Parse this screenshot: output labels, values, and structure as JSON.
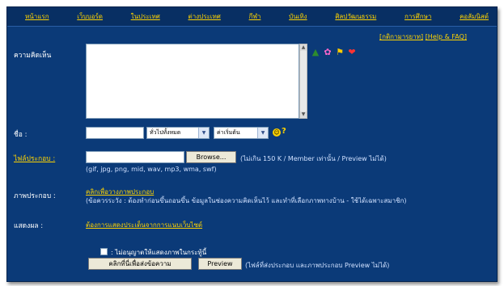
{
  "nav": [
    "หน้าแรก",
    "เว็บบอร์ด",
    "ในประเทศ",
    "ต่างประเทศ",
    "กีฬา",
    "บันเทิง",
    "ศิลปวัฒนธรรม",
    "การศึกษา",
    "คอลัมนิสต์"
  ],
  "help_links": {
    "terms": "[กติกามารยาท]",
    "help": "[Help & FAQ]"
  },
  "labels": {
    "opinion": "ความคิดเห็น",
    "name": "ชื่อ :",
    "attach": "ไฟล์ประกอบ :",
    "image_url": "ภาพประกอบ :",
    "url": "แสดงผล :"
  },
  "name_select": "ทั่วไปทั้งหมด",
  "color_select": "ค่าเริ่มต้น",
  "browse_label": "Browse...",
  "attach_note": "(ไม่เกิน 150 K / Member เท่านั้น / Preview ไม่ได้)",
  "attach_types": "(gif, jpg, png, mid, wav, mp3, wma, swf)",
  "image_link": "คลิกเพื่อวางภาพประกอบ",
  "image_note": "(ข้อควรระวัง : ต้องทำก่อนขึ้นถอนขึ้น ข้อมูลในช่องความคิดเห็นไว้ และทำที่เลือกภาพทางบ้าน - ใช้ได้เฉพาะสมาชิก)",
  "display_link": "ต้องการแสดงประเด็นจากการแนบเว็บไซต์",
  "checkbox_label": ": ไม่อนุญาตให้แสดงภาพในกระทู้นี้",
  "submit_label": "คลิกที่นี่เพื่อส่งข้อความ",
  "preview_label": "Preview",
  "preview_note": "(ไฟล์ที่ส่งประกอบ และภาพประกอบ Preview ไม่ได้)",
  "emoticons": [
    "tree-icon",
    "flower-icon",
    "flag-icon",
    "heart-icon"
  ],
  "colors": {
    "bg": "#0b3a78",
    "link": "#ffd400",
    "text": "#ffffff"
  }
}
